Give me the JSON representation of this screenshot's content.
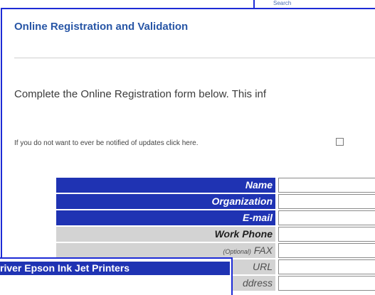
{
  "background_window": {
    "top_text": "Search"
  },
  "main": {
    "title": "Online Registration and Validation",
    "intro": "Complete the Online Registration form below. This inf",
    "optout_text": "If you do not want to ever be notified of updates click here.",
    "form": {
      "name_label": "Name",
      "organization_label": "Organization",
      "email_label": "E-mail",
      "work_phone_label": "Work Phone",
      "fax_optional": "(Optional)",
      "fax_label": "FAX",
      "url_label": "URL",
      "address_label": "ddress"
    }
  },
  "popup": {
    "title": "river Epson Ink Jet Printers"
  },
  "colors": {
    "accent_blue": "#1f33b3",
    "link_blue": "#2856a6",
    "row_gray": "#d3d3d3"
  }
}
